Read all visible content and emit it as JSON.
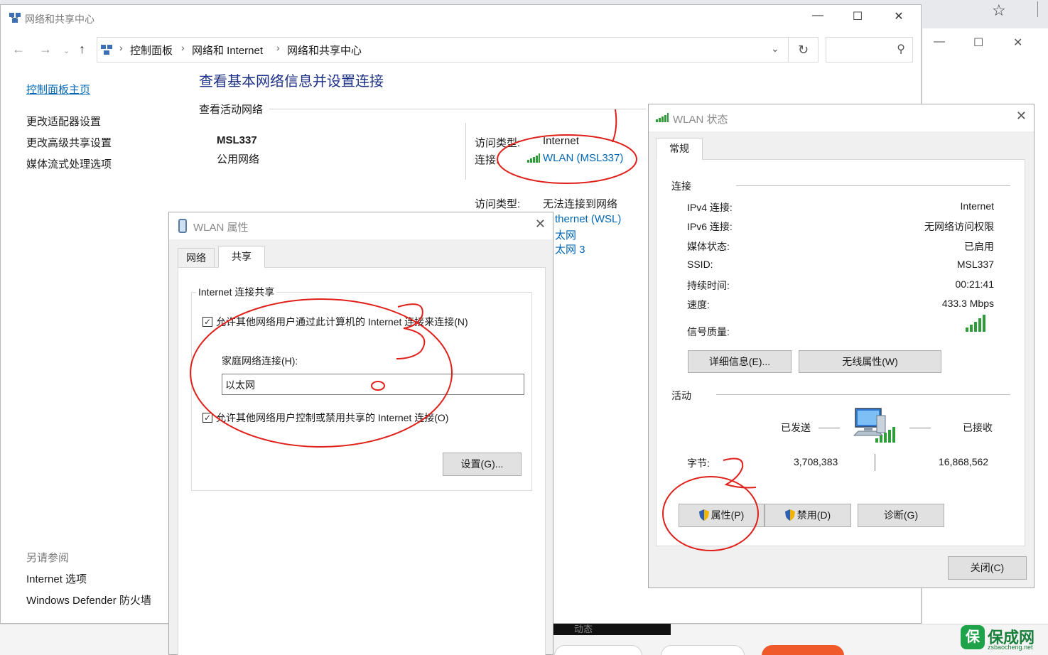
{
  "background": {
    "watermark_text": "保成网",
    "watermark_url": "zsbaocheng.net",
    "watermark_badge": "保",
    "black_strip_text": "动态"
  },
  "main_window": {
    "title": "网络和共享中心",
    "breadcrumb": [
      "控制面板",
      "网络和 Internet",
      "网络和共享中心"
    ],
    "sidebar": {
      "home": "控制面板主页",
      "items": [
        "更改适配器设置",
        "更改高级共享设置",
        "媒体流式处理选项"
      ],
      "see_also_heading": "另请参阅",
      "see_also": [
        "Internet 选项",
        "Windows Defender 防火墙"
      ]
    },
    "page_title": "查看基本网络信息并设置连接",
    "active_networks_heading": "查看活动网络",
    "network1": {
      "name": "MSL337",
      "type": "公用网络",
      "access_label": "访问类型:",
      "access_value": "Internet",
      "conn_label": "连接:",
      "conn_value": "WLAN (MSL337)"
    },
    "network2": {
      "access_label": "访问类型:",
      "access_value": "无法连接到网络",
      "connections": [
        "thernet (WSL)",
        "太网",
        "太网 3"
      ]
    }
  },
  "wlan_properties": {
    "title": "WLAN 属性",
    "tabs": [
      "网络",
      "共享"
    ],
    "active_tab": "共享",
    "group_title": "Internet 连接共享",
    "allow_connect_label": "允许其他网络用户通过此计算机的 Internet 连接来连接(N)",
    "allow_connect_checked": true,
    "home_label": "家庭网络连接(H):",
    "home_value": "以太网",
    "allow_control_label": "允许其他网络用户控制或禁用共享的 Internet 连接(O)",
    "allow_control_checked": true,
    "settings_button": "设置(G)..."
  },
  "wlan_status": {
    "title": "WLAN 状态",
    "tab": "常规",
    "connection_heading": "连接",
    "fields": [
      {
        "label": "IPv4 连接:",
        "value": "Internet"
      },
      {
        "label": "IPv6 连接:",
        "value": "无网络访问权限"
      },
      {
        "label": "媒体状态:",
        "value": "已启用"
      },
      {
        "label": "SSID:",
        "value": "MSL337"
      },
      {
        "label": "持续时间:",
        "value": "00:21:41"
      },
      {
        "label": "速度:",
        "value": "433.3 Mbps"
      }
    ],
    "signal_label": "信号质量:",
    "details_button": "详细信息(E)...",
    "wireless_props_button": "无线属性(W)",
    "activity_heading": "活动",
    "sent_label": "已发送",
    "received_label": "已接收",
    "bytes_label": "字节:",
    "bytes_sent": "3,708,383",
    "bytes_received": "16,868,562",
    "properties_button": "属性(P)",
    "disable_button": "禁用(D)",
    "diagnose_button": "诊断(G)",
    "close_button": "关闭(C)"
  },
  "colors": {
    "link_blue": "#0066b4",
    "title_blue": "#1e3287",
    "signal_green": "#2e9d3a",
    "annotation_red": "#e0201a"
  },
  "icons": [
    "network-center-icon",
    "back-arrow-icon",
    "forward-arrow-icon",
    "up-arrow-icon",
    "refresh-icon",
    "search-icon",
    "wifi-signal-icon",
    "network-adapter-icon",
    "uac-shield-icon",
    "computer-network-icon",
    "star-icon"
  ]
}
